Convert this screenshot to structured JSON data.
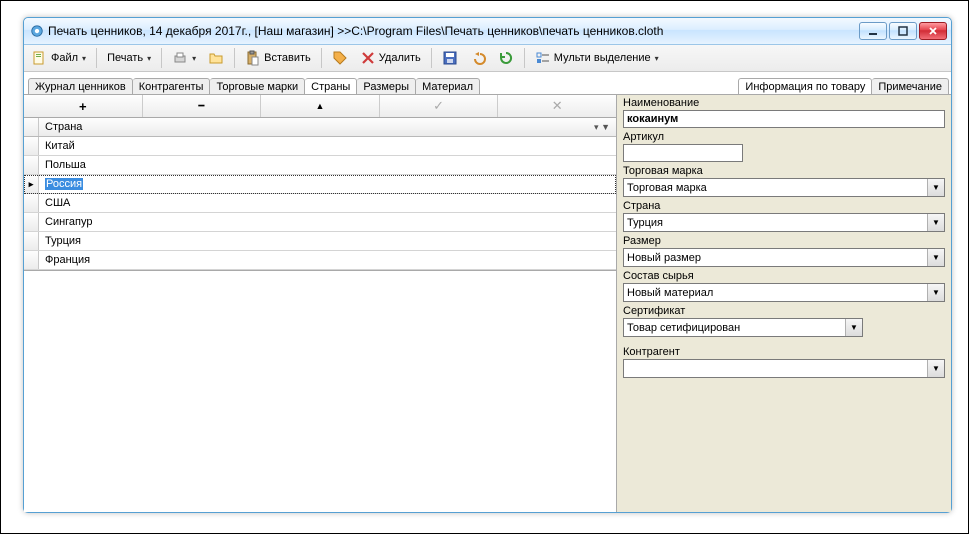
{
  "window": {
    "title": "Печать ценников, 14 декабря 2017г., [Наш магазин] >>C:\\Program Files\\Печать ценников\\печать ценников.cloth"
  },
  "toolbar": {
    "file": "Файл",
    "print": "Печать",
    "paste": "Вставить",
    "delete": "Удалить",
    "multi_select": "Мульти выделение"
  },
  "tabs_left": [
    {
      "label": "Журнал ценников"
    },
    {
      "label": "Контрагенты"
    },
    {
      "label": "Торговые марки"
    },
    {
      "label": "Страны"
    },
    {
      "label": "Размеры"
    },
    {
      "label": "Материал"
    }
  ],
  "tabs_left_active": 3,
  "tabs_right": [
    {
      "label": "Информация по товару"
    },
    {
      "label": "Примечание"
    }
  ],
  "tabs_right_active": 0,
  "nav": {
    "plus": "+",
    "minus": "━",
    "up": "▲",
    "check": "✓",
    "cancel": "✕"
  },
  "grid": {
    "column": "Страна",
    "rows": [
      "Китай",
      "Польша",
      "Россия",
      "США",
      "Сингапур",
      "Турция",
      "Франция"
    ],
    "selected_index": 2
  },
  "form": {
    "name_label": "Наименование",
    "name_value": "кокаинум",
    "article_label": "Артикул",
    "article_value": "",
    "brand_label": "Торговая марка",
    "brand_value": "Торговая марка",
    "country_label": "Страна",
    "country_value": "Турция",
    "size_label": "Размер",
    "size_value": "Новый размер",
    "material_label": "Состав сырья",
    "material_value": "Новый материал",
    "cert_label": "Сертификат",
    "cert_value": "Товар сетифицирован",
    "counter_label": "Контрагент",
    "counter_value": ""
  }
}
